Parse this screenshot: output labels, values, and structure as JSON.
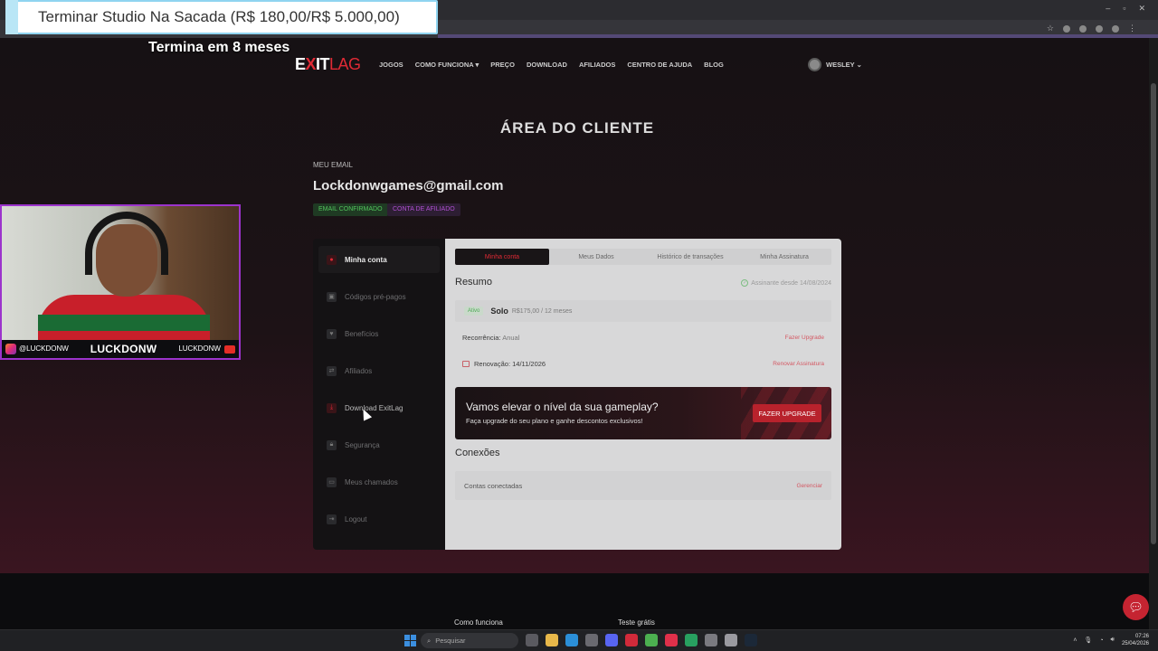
{
  "overlay": {
    "goal_text": "Terminar Studio Na Sacada (R$ 180,00/R$ 5.000,00)",
    "goal_subtitle": "Termina em 8 meses",
    "webcam": {
      "instagram_handle": "@LUCKDONW",
      "channel_name": "LUCKDONW",
      "youtube_handle": "LUCKDONW"
    }
  },
  "site": {
    "logo_text": "EXITLAG",
    "nav": [
      "JOGOS",
      "COMO FUNCIONA ▾",
      "PREÇO",
      "DOWNLOAD",
      "AFILIADOS",
      "CENTRO DE AJUDA",
      "BLOG"
    ],
    "user_name": "WESLEY ⌄",
    "page_title": "ÁREA DO CLIENTE",
    "email_label": "MEU EMAIL",
    "email": "Lockdonwgames@gmail.com",
    "badges": {
      "email_confirmed": "EMAIL CONFIRMADO",
      "affiliate": "CONTA DE AFILIADO"
    },
    "sidebar": [
      {
        "label": "Minha conta",
        "icon": "user-icon"
      },
      {
        "label": "Códigos pré-pagos",
        "icon": "ticket-icon"
      },
      {
        "label": "Benefícios",
        "icon": "heart-icon"
      },
      {
        "label": "Afiliados",
        "icon": "swap-icon"
      },
      {
        "label": "Download ExitLag",
        "icon": "download-icon"
      },
      {
        "label": "Segurança",
        "icon": "lock-icon"
      },
      {
        "label": "Meus chamados",
        "icon": "ticket-icon"
      },
      {
        "label": "Logout",
        "icon": "logout-icon"
      }
    ],
    "tabs": [
      "Minha conta",
      "Meus Dados",
      "Histórico de transações",
      "Minha Assinatura"
    ],
    "summary": {
      "title": "Resumo",
      "since": "Assinante desde 14/08/2024",
      "status": "Ativo",
      "plan": "Solo",
      "price": "R$175,00 / 12 meses",
      "recurrence_label": "Recorrência:",
      "recurrence_value": "Anual",
      "upgrade_link": "Fazer Upgrade",
      "renewal": "Renovação: 14/11/2026",
      "renew_link": "Renovar Assinatura"
    },
    "banner": {
      "title": "Vamos elevar o nível da sua gameplay?",
      "subtitle": "Faça upgrade do seu plano e ganhe descontos exclusivos!",
      "button": "FAZER UPGRADE"
    },
    "connections": {
      "title": "Conexões",
      "row_label": "Contas conectadas",
      "manage_link": "Gerenciar"
    },
    "footer": {
      "link1": "Como funciona",
      "link2": "Teste grátis"
    }
  },
  "taskbar": {
    "search_placeholder": "Pesquisar",
    "time": "07:26",
    "date": "25/04/2026"
  },
  "colors": {
    "accent": "#e02a35",
    "success": "#52c45c",
    "affiliate": "#b04fd1"
  }
}
